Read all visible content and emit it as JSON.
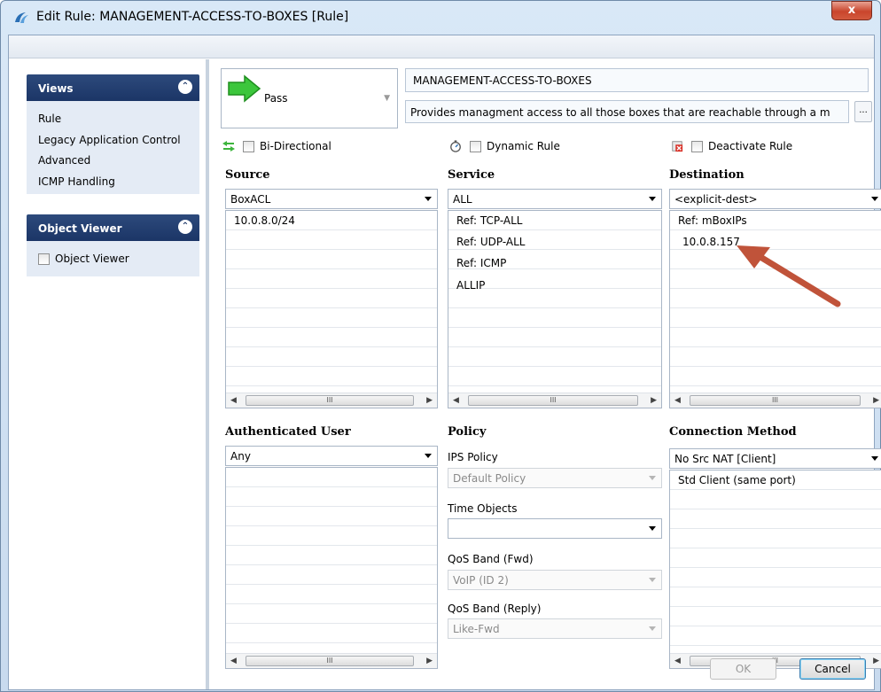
{
  "window": {
    "title": "Edit Rule: MANAGEMENT-ACCESS-TO-BOXES [Rule]",
    "close_label": "x"
  },
  "views": {
    "title": "Views",
    "items": [
      "Rule",
      "Legacy Application Control",
      "Advanced",
      "ICMP Handling"
    ]
  },
  "object_viewer": {
    "title": "Object Viewer",
    "checkbox_label": "Object Viewer"
  },
  "rule": {
    "action": "Pass",
    "name": "MANAGEMENT-ACCESS-TO-BOXES",
    "description": "Provides managment access to all those boxes that are reachable through a m",
    "description_button": "...",
    "options": {
      "bidirectional": "Bi-Directional",
      "dynamic": "Dynamic Rule",
      "deactivate": "Deactivate Rule"
    }
  },
  "source": {
    "header": "Source",
    "selected": "BoxACL",
    "items": [
      "10.0.8.0/24"
    ]
  },
  "service": {
    "header": "Service",
    "selected": "ALL",
    "items": [
      "Ref: TCP-ALL",
      "Ref: UDP-ALL",
      "Ref: ICMP",
      "ALLIP"
    ]
  },
  "destination": {
    "header": "Destination",
    "selected": "<explicit-dest>",
    "items": [
      "Ref: mBoxIPs",
      "10.0.8.157"
    ]
  },
  "auth_user": {
    "header": "Authenticated User",
    "selected": "Any"
  },
  "policy": {
    "header": "Policy",
    "ips_label": "IPS Policy",
    "ips_value": "Default Policy",
    "time_label": "Time Objects",
    "time_value": "",
    "qos_fwd_label": "QoS Band (Fwd)",
    "qos_fwd_value": "VoIP (ID 2)",
    "qos_reply_label": "QoS Band (Reply)",
    "qos_reply_value": "Like-Fwd"
  },
  "connection": {
    "header": "Connection Method",
    "selected": "No Src NAT [Client]",
    "items": [
      "Std Client (same port)"
    ]
  },
  "scrollbar_grip": "III",
  "buttons": {
    "ok": "OK",
    "cancel": "Cancel"
  },
  "colors": {
    "accent": "#1b3566",
    "annotation_arrow": "#c0533a",
    "pass_green": "#2fb52f"
  }
}
